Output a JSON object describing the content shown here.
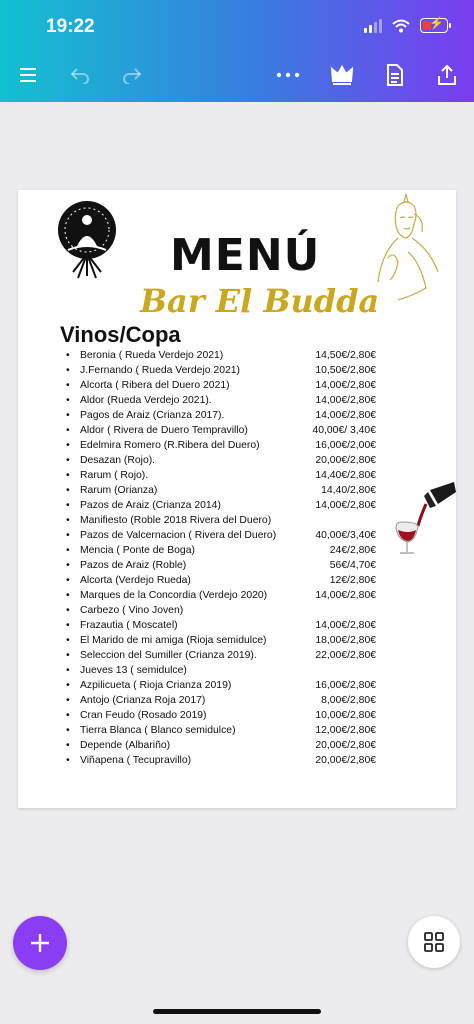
{
  "status_bar": {
    "time": "19:22"
  },
  "toolbar": {
    "icons": [
      "menu-icon",
      "undo-icon",
      "redo-icon",
      "more-icon",
      "crown-icon",
      "document-icon",
      "share-icon"
    ]
  },
  "menu": {
    "title": "MENÚ",
    "bar_name": "Bar El Budda",
    "section": "Vinos/Copa",
    "bullet": "•",
    "wines": [
      {
        "name": "Beronia ( Rueda Verdejo 2021)",
        "price": "14,50€/2,80€"
      },
      {
        "name": "J.Fernando ( Rueda Verdejo 2021)",
        "price": "10,50€/2,80€"
      },
      {
        "name": "Alcorta ( Ribera del Duero 2021)",
        "price": "14,00€/2,80€"
      },
      {
        "name": "Aldor (Rueda Verdejo 2021).",
        "price": "14,00€/2,80€"
      },
      {
        "name": "Pagos de Araiz (Crianza 2017).",
        "price": "14,00€/2,80€"
      },
      {
        "name": "Aldor ( Rivera de Duero Tempravillo)",
        "price": "40,00€/ 3,40€"
      },
      {
        "name": "Edelmira Romero (R.Ribera del Duero)",
        "price": "16,00€/2,00€"
      },
      {
        "name": "Desazan (Rojo).",
        "price": "20,00€/2,80€"
      },
      {
        "name": "Rarum ( Rojo).",
        "price": "14,40€/2,80€"
      },
      {
        "name": "Rarum (Orianza)",
        "price": "14,40/2,80€"
      },
      {
        "name": "Pazos de Araiz (Crianza 2014)",
        "price": "14,00€/2,80€"
      },
      {
        "name": "Manifiesto (Roble 2018 Rivera del Duero)",
        "price": ""
      },
      {
        "name": "Pazos de Valcernacion ( Rivera del Duero)",
        "price": "40,00€/3,40€"
      },
      {
        "name": "Mencia ( Ponte de Boga)",
        "price": "24€/2,80€"
      },
      {
        "name": "Pazos de Araiz (Roble)",
        "price": "56€/4,70€"
      },
      {
        "name": "Alcorta (Verdejo Rueda)",
        "price": "12€/2,80€"
      },
      {
        "name": "Marques de la Concordia (Verdejo 2020)",
        "price": "14,00€/2,80€"
      },
      {
        "name": "Carbezo ( Vino Joven)",
        "price": ""
      },
      {
        "name": "Frazautia ( Moscatel)",
        "price": "14,00€/2,80€"
      },
      {
        "name": "El Marido de mi amiga (Rioja semidulce)",
        "price": "18,00€/2,80€"
      },
      {
        "name": "Seleccion del Sumiller (Crianza 2019).",
        "price": "22,00€/2,80€"
      },
      {
        "name": "Jueves 13 ( semidulce)",
        "price": ""
      },
      {
        "name": "Azpilicueta ( Rioja Crianza 2019)",
        "price": "16,00€/2,80€"
      },
      {
        "name": "Antojo (Crianza Roja 2017)",
        "price": "8,00€/2,80€"
      },
      {
        "name": "Cran Feudo (Rosado 2019)",
        "price": "10,00€/2,80€"
      },
      {
        "name": "Tierra Blanca ( Blanco semidulce)",
        "price": "12,00€/2,80€"
      },
      {
        "name": "Depende (Albariño)",
        "price": "20,00€/2,80€"
      },
      {
        "name": "Viñapena ( Tecupravillo)",
        "price": "20,00€/2,80€"
      }
    ]
  },
  "bottom": {
    "icons": [
      "plus-icon",
      "grid-icon"
    ]
  }
}
